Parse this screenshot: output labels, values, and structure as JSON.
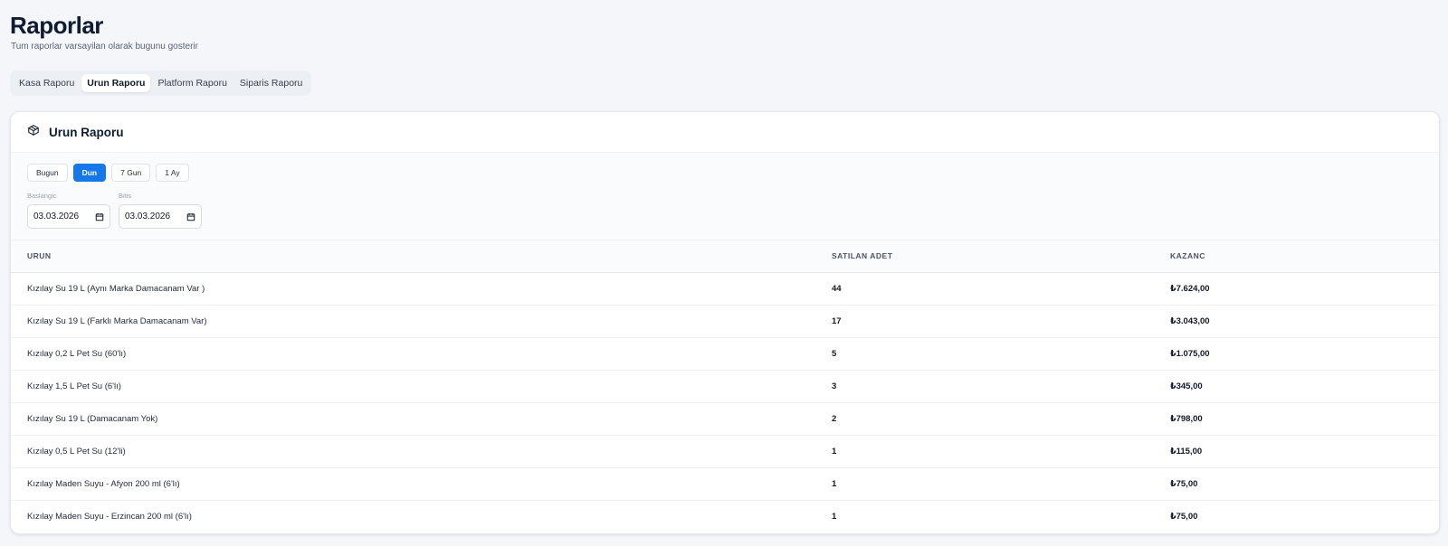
{
  "page": {
    "title": "Raporlar",
    "subtitle": "Tum raporlar varsayilan olarak bugunu gosterir"
  },
  "tabs": [
    {
      "label": "Kasa Raporu",
      "active": false
    },
    {
      "label": "Urun Raporu",
      "active": true
    },
    {
      "label": "Platform Raporu",
      "active": false
    },
    {
      "label": "Siparis Raporu",
      "active": false
    }
  ],
  "card": {
    "title": "Urun Raporu",
    "icon": "box-icon"
  },
  "filters": {
    "ranges": [
      {
        "label": "Bugun",
        "active": false
      },
      {
        "label": "Dun",
        "active": true
      },
      {
        "label": "7 Gun",
        "active": false
      },
      {
        "label": "1 Ay",
        "active": false
      }
    ],
    "start_label": "Baslangic",
    "start_value": "03.03.2026",
    "end_label": "Bitis",
    "end_value": "03.03.2026"
  },
  "table": {
    "headers": [
      "URUN",
      "SATILAN ADET",
      "KAZANC"
    ],
    "rows": [
      {
        "product": "Kızılay Su 19 L (Aynı Marka Damacanam Var )",
        "qty": "44",
        "revenue": "₺7.624,00"
      },
      {
        "product": "Kızılay Su 19 L (Farklı Marka Damacanam Var)",
        "qty": "17",
        "revenue": "₺3.043,00"
      },
      {
        "product": "Kızılay 0,2 L Pet Su (60'lı)",
        "qty": "5",
        "revenue": "₺1.075,00"
      },
      {
        "product": "Kızılay 1,5 L Pet Su (6'lı)",
        "qty": "3",
        "revenue": "₺345,00"
      },
      {
        "product": "Kızılay Su 19 L (Damacanam Yok)",
        "qty": "2",
        "revenue": "₺798,00"
      },
      {
        "product": "Kızılay 0,5 L Pet Su (12'li)",
        "qty": "1",
        "revenue": "₺115,00"
      },
      {
        "product": "Kızılay Maden Suyu - Afyon 200 ml (6'lı)",
        "qty": "1",
        "revenue": "₺75,00"
      },
      {
        "product": "Kızılay Maden Suyu - Erzincan 200 ml (6'lı)",
        "qty": "1",
        "revenue": "₺75,00"
      }
    ]
  },
  "colors": {
    "accent": "#1677e8",
    "background": "#f4f6f9",
    "title": "#0f1b33"
  }
}
